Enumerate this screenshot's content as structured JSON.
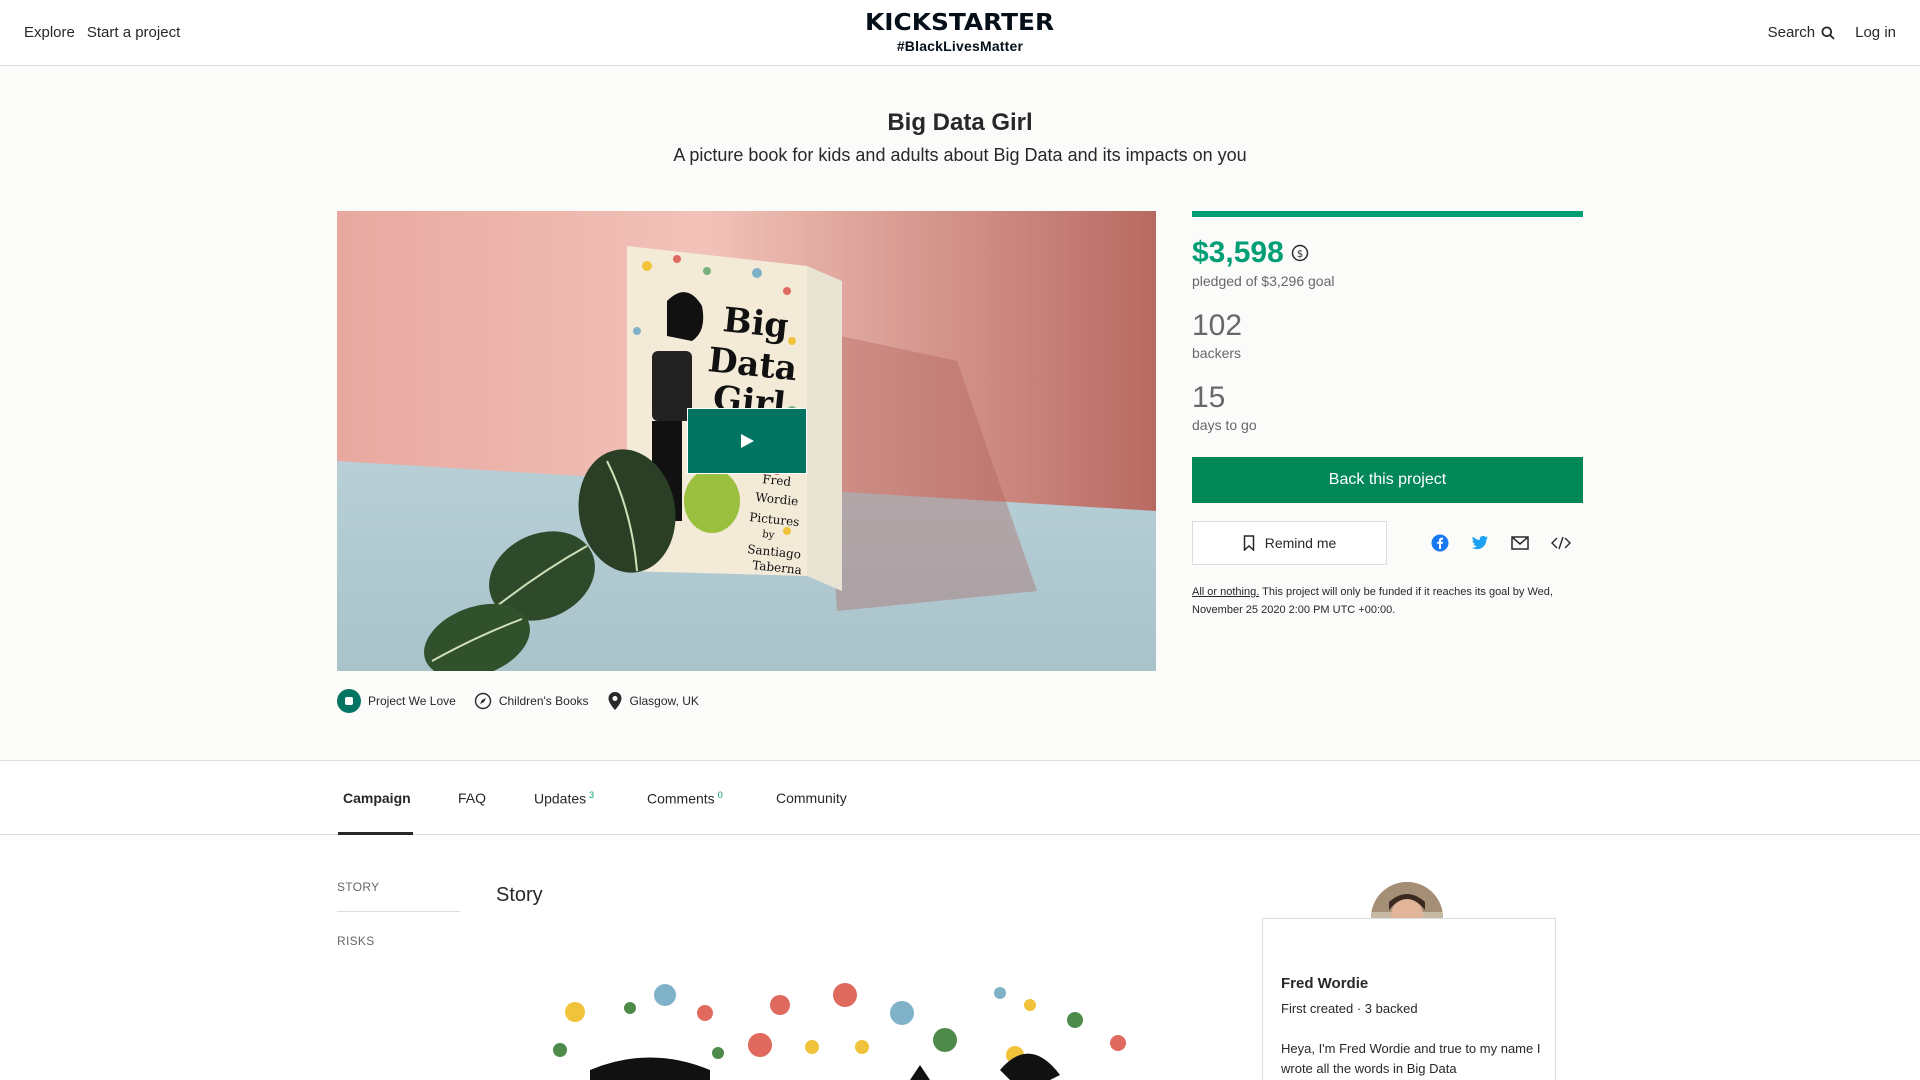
{
  "header": {
    "nav_explore": "Explore",
    "nav_start": "Start a project",
    "brand": "KICKSTARTER",
    "tagline": "#BlackLivesMatter",
    "search_label": "Search",
    "login_label": "Log in"
  },
  "project": {
    "title": "Big Data Girl",
    "subtitle": "A picture book for kids and adults about Big Data and its impacts on you",
    "badge_label": "Project We Love",
    "category": "Children's Books",
    "location": "Glasgow, UK"
  },
  "book_cover": {
    "line1": "Big",
    "line2": "Data",
    "line3": "Girl",
    "author": "Fred",
    "author2": "Wordie",
    "pictures": "Pictures",
    "by": "by",
    "illustrator": "Santiago",
    "illustrator2": "Taberna"
  },
  "stats": {
    "progress_fraction": 1.0,
    "pledged": "$3,598",
    "pledged_sub": "pledged of $3,296 goal",
    "backers": "102",
    "backers_label": "backers",
    "days": "15",
    "days_label": "days to go",
    "back_button": "Back this project",
    "remind_button": "Remind me",
    "aon_link": "All or nothing.",
    "fine_print": " This project will only be funded if it reaches its goal by Wed, November 25 2020 2:00 PM UTC +00:00."
  },
  "tabs": [
    {
      "label": "Campaign",
      "count": ""
    },
    {
      "label": "FAQ",
      "count": ""
    },
    {
      "label": "Updates",
      "count": "3"
    },
    {
      "label": "Comments",
      "count": "0"
    },
    {
      "label": "Community",
      "count": ""
    }
  ],
  "toc": {
    "story": "STORY",
    "risks": "RISKS"
  },
  "story": {
    "heading": "Story"
  },
  "creator": {
    "name": "Fred Wordie",
    "stats": "First created · 3 backed",
    "bio": "Heya, I'm Fred Wordie and true to my name I wrote all the words in Big Data"
  },
  "colors": {
    "accent_green": "#009e74",
    "button_green": "#028858",
    "play_teal": "#037362"
  }
}
